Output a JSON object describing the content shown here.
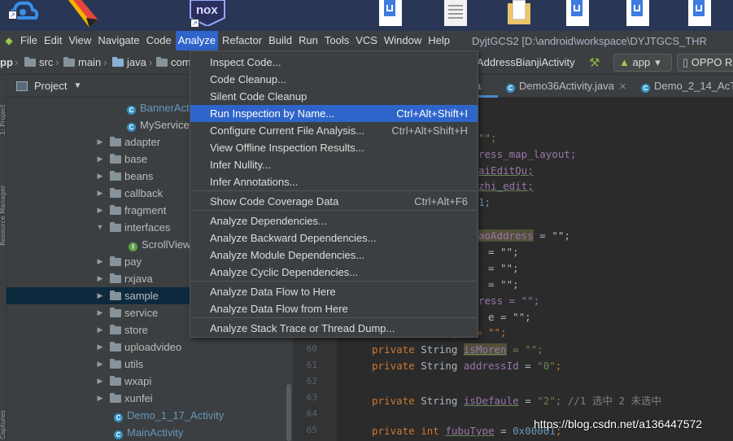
{
  "window": {
    "title": "DyjtGCS2 [D:\\android\\workspace\\DYJTGCS_THR"
  },
  "desktop": {
    "nox_label": "nox"
  },
  "menubar": {
    "items": [
      "File",
      "Edit",
      "View",
      "Navigate",
      "Code",
      "Analyze",
      "Refactor",
      "Build",
      "Run",
      "Tools",
      "VCS",
      "Window",
      "Help"
    ],
    "active": "Analyze"
  },
  "navbar": {
    "crumbs": [
      "pp",
      "src",
      "main",
      "java",
      "com"
    ],
    "file": "AddressBianjiActivity",
    "run_config": "app",
    "device": "OPPO R"
  },
  "project_panel": {
    "title": "Project",
    "rows": [
      {
        "label": "BannerActivity",
        "type": "class"
      },
      {
        "label": "MyService",
        "type": "class"
      },
      {
        "label": "adapter",
        "type": "folder"
      },
      {
        "label": "base",
        "type": "folder"
      },
      {
        "label": "beans",
        "type": "folder"
      },
      {
        "label": "callback",
        "type": "folder"
      },
      {
        "label": "fragment",
        "type": "folder"
      },
      {
        "label": "interfaces",
        "type": "folder"
      },
      {
        "label": "ScrollViewListener",
        "type": "interface"
      },
      {
        "label": "pay",
        "type": "folder"
      },
      {
        "label": "rxjava",
        "type": "folder"
      },
      {
        "label": "sample",
        "type": "folder"
      },
      {
        "label": "service",
        "type": "folder"
      },
      {
        "label": "store",
        "type": "folder"
      },
      {
        "label": "uploadvideo",
        "type": "folder"
      },
      {
        "label": "utils",
        "type": "folder"
      },
      {
        "label": "wxapi",
        "type": "folder"
      },
      {
        "label": "xunfei",
        "type": "folder"
      },
      {
        "label": "Demo_1_17_Activity",
        "type": "class"
      },
      {
        "label": "MainActivity",
        "type": "class"
      }
    ],
    "selected": "sample"
  },
  "editor": {
    "tabs": [
      {
        "label": "a"
      },
      {
        "label": "Demo36Activity.java"
      },
      {
        "label": "Demo_2_14_AcTI"
      }
    ],
    "line_numbers": [
      "60",
      "61",
      "62",
      "63",
      "64",
      "65"
    ],
    "code_fragments": {
      "r1": "\"\";",
      "r2": "ress_map_layout;",
      "r3": "aiEditQu;",
      "r4": "zhi_edit;",
      "r5": "1;",
      "r6_field": "aoAddress",
      "r6_rest": " = \"\";",
      "r7": "= \"\";",
      "r8": "= \"\";",
      "r9": "= \"\";",
      "r10": "ress = \"\";",
      "r11": "e = \"\";",
      "r12": "private String   = \"\";",
      "line60_kw": "private",
      "line60_type": "String",
      "line60_field": "isMoren",
      "line60_rest": " = \"\";",
      "line61_kw": "private",
      "line61_type": "String",
      "line61_field": "addressId",
      "line61_eq": " = ",
      "line61_val": "\"0\"",
      "line61_end": ";",
      "line63_kw": "private",
      "line63_type": "String",
      "line63_field": "isDefaule",
      "line63_eq": " = ",
      "line63_val": "\"2\"",
      "line63_cmt": "; //1 选中 2 未选中",
      "line65_kw": "private",
      "line65_type": "int",
      "line65_field": "fubuType",
      "line65_eq": " = ",
      "line65_val": "0x00001",
      "line65_end": ";"
    }
  },
  "analyze_menu": {
    "items": [
      {
        "label": "Inspect Code...",
        "shortcut": ""
      },
      {
        "label": "Code Cleanup...",
        "shortcut": ""
      },
      {
        "label": "Silent Code Cleanup",
        "shortcut": ""
      },
      {
        "label": "Run Inspection by Name...",
        "shortcut": "Ctrl+Alt+Shift+I"
      },
      {
        "label": "Configure Current File Analysis...",
        "shortcut": "Ctrl+Alt+Shift+H"
      },
      {
        "label": "View Offline Inspection Results...",
        "shortcut": ""
      },
      {
        "label": "Infer Nullity...",
        "shortcut": ""
      },
      {
        "label": "Infer Annotations...",
        "shortcut": ""
      },
      {
        "label": "Show Code Coverage Data",
        "shortcut": "Ctrl+Alt+F6"
      },
      {
        "label": "Analyze Dependencies...",
        "shortcut": ""
      },
      {
        "label": "Analyze Backward Dependencies...",
        "shortcut": ""
      },
      {
        "label": "Analyze Module Dependencies...",
        "shortcut": ""
      },
      {
        "label": "Analyze Cyclic Dependencies...",
        "shortcut": ""
      },
      {
        "label": "Analyze Data Flow to Here",
        "shortcut": ""
      },
      {
        "label": "Analyze Data Flow from Here",
        "shortcut": ""
      },
      {
        "label": "Analyze Stack Trace or Thread Dump...",
        "shortcut": ""
      }
    ],
    "highlighted": "Run Inspection by Name..."
  },
  "watermark": "https://blog.csdn.net/a136447572",
  "colors": {
    "menu_highlight": "#2f65ca",
    "tree_selected": "#0d293e",
    "keyword": "#cc7832",
    "field": "#9876aa",
    "string": "#6a8759"
  }
}
